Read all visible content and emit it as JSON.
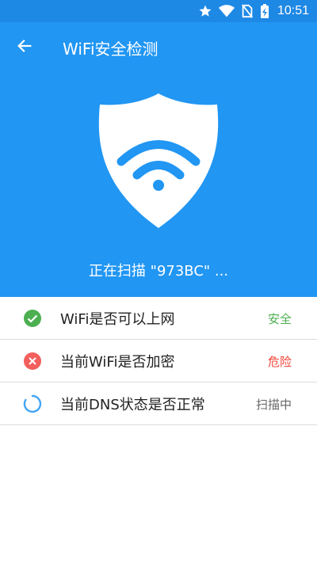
{
  "status_bar": {
    "time": "10:51",
    "icons": [
      "star-icon",
      "wifi-signal-icon",
      "no-sim-icon",
      "battery-charging-icon"
    ]
  },
  "toolbar": {
    "title": "WiFi安全检测",
    "back_icon": "arrow-back-icon"
  },
  "hero": {
    "icon": "shield-wifi-icon",
    "scan_text": "正在扫描 \"973BC\" ..."
  },
  "checks": [
    {
      "label": "WiFi是否可以上网",
      "status": "安全",
      "state": "safe",
      "icon": "check-circle-icon"
    },
    {
      "label": "当前WiFi是否加密",
      "status": "危险",
      "state": "danger",
      "icon": "error-circle-icon"
    },
    {
      "label": "当前DNS状态是否正常",
      "status": "扫描中",
      "state": "scanning",
      "icon": "loading-spinner-icon"
    }
  ],
  "colors": {
    "status_bar": "#1E88E5",
    "header": "#2196F3",
    "safe": "#4CAF50",
    "danger": "#F44336",
    "scanning": "#666666"
  }
}
